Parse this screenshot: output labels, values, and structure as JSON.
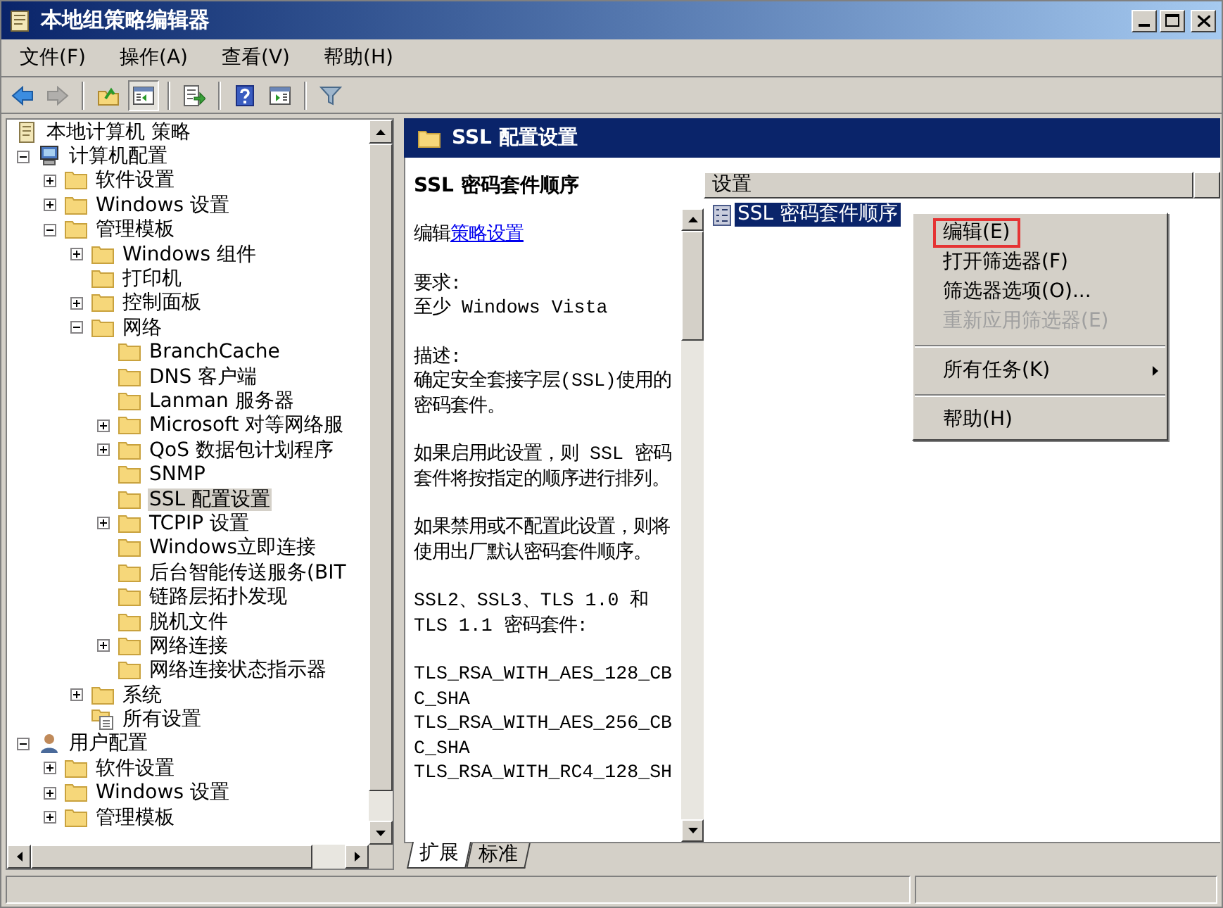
{
  "window": {
    "title": "本地组策略编辑器"
  },
  "menu": [
    "文件(F)",
    "操作(A)",
    "查看(V)",
    "帮助(H)"
  ],
  "toolbar": [
    {
      "kind": "back",
      "disabled": false,
      "pressed": false
    },
    {
      "kind": "forward",
      "disabled": true,
      "pressed": false
    },
    {
      "kind": "separator"
    },
    {
      "kind": "up",
      "disabled": false,
      "pressed": false
    },
    {
      "kind": "tree",
      "disabled": false,
      "pressed": true
    },
    {
      "kind": "separator"
    },
    {
      "kind": "export",
      "disabled": false,
      "pressed": false
    },
    {
      "kind": "separator"
    },
    {
      "kind": "help",
      "disabled": false,
      "pressed": false
    },
    {
      "kind": "action-pane",
      "disabled": false,
      "pressed": false
    },
    {
      "kind": "separator"
    },
    {
      "kind": "filter",
      "disabled": false,
      "pressed": false
    }
  ],
  "tree": [
    {
      "label": "本地计算机 策略",
      "kind": "policy",
      "selected": false,
      "children": [
        {
          "label": "计算机配置",
          "kind": "computer",
          "expandable": true,
          "expanded": true,
          "selected": false,
          "children": [
            {
              "label": "软件设置",
              "kind": "folder",
              "expandable": true,
              "expanded": false,
              "selected": false
            },
            {
              "label": "Windows 设置",
              "kind": "folder",
              "expandable": true,
              "expanded": false,
              "selected": false
            },
            {
              "label": "管理模板",
              "kind": "folder",
              "expandable": true,
              "expanded": true,
              "selected": false,
              "children": [
                {
                  "label": "Windows 组件",
                  "kind": "folder",
                  "expandable": true,
                  "expanded": false,
                  "selected": false
                },
                {
                  "label": "打印机",
                  "kind": "folder",
                  "expandable": false,
                  "selected": false
                },
                {
                  "label": "控制面板",
                  "kind": "folder",
                  "expandable": true,
                  "expanded": false,
                  "selected": false
                },
                {
                  "label": "网络",
                  "kind": "folder",
                  "expandable": true,
                  "expanded": true,
                  "selected": false,
                  "children": [
                    {
                      "label": "BranchCache",
                      "kind": "folder",
                      "expandable": false,
                      "selected": false
                    },
                    {
                      "label": "DNS 客户端",
                      "kind": "folder",
                      "expandable": false,
                      "selected": false
                    },
                    {
                      "label": "Lanman 服务器",
                      "kind": "folder",
                      "expandable": false,
                      "selected": false
                    },
                    {
                      "label": "Microsoft 对等网络服",
                      "kind": "folder",
                      "expandable": true,
                      "expanded": false,
                      "selected": false
                    },
                    {
                      "label": "QoS 数据包计划程序",
                      "kind": "folder",
                      "expandable": true,
                      "expanded": false,
                      "selected": false
                    },
                    {
                      "label": "SNMP",
                      "kind": "folder",
                      "expandable": false,
                      "selected": false
                    },
                    {
                      "label": "SSL 配置设置",
                      "kind": "folder",
                      "expandable": false,
                      "selected": true
                    },
                    {
                      "label": "TCPIP 设置",
                      "kind": "folder",
                      "expandable": true,
                      "expanded": false,
                      "selected": false
                    },
                    {
                      "label": "Windows立即连接",
                      "kind": "folder",
                      "expandable": false,
                      "selected": false
                    },
                    {
                      "label": "后台智能传送服务(BIT",
                      "kind": "folder",
                      "expandable": false,
                      "selected": false
                    },
                    {
                      "label": "链路层拓扑发现",
                      "kind": "folder",
                      "expandable": false,
                      "selected": false
                    },
                    {
                      "label": "脱机文件",
                      "kind": "folder",
                      "expandable": false,
                      "selected": false
                    },
                    {
                      "label": "网络连接",
                      "kind": "folder",
                      "expandable": true,
                      "expanded": false,
                      "selected": false
                    },
                    {
                      "label": "网络连接状态指示器",
                      "kind": "folder",
                      "expandable": false,
                      "selected": false
                    }
                  ]
                },
                {
                  "label": "系统",
                  "kind": "folder",
                  "expandable": true,
                  "expanded": false,
                  "selected": false
                },
                {
                  "label": "所有设置",
                  "kind": "settings",
                  "expandable": false,
                  "selected": false
                }
              ]
            }
          ]
        },
        {
          "label": "用户配置",
          "kind": "user",
          "expandable": true,
          "expanded": true,
          "selected": false,
          "children": [
            {
              "label": "软件设置",
              "kind": "folder",
              "expandable": true,
              "expanded": false,
              "selected": false
            },
            {
              "label": "Windows 设置",
              "kind": "folder",
              "expandable": true,
              "expanded": false,
              "selected": false
            },
            {
              "label": "管理模板",
              "kind": "folder",
              "expandable": true,
              "expanded": false,
              "selected": false
            }
          ]
        }
      ]
    }
  ],
  "header": {
    "title": "SSL 配置设置"
  },
  "description": {
    "heading": "SSL 密码套件顺序",
    "edit_prefix": "编辑",
    "edit_link": "策略设置",
    "paragraphs": [
      "要求:\n至少 Windows Vista",
      "描述:\n确定安全套接字层(SSL)使用的密码套件。",
      "如果启用此设置，则 SSL 密码套件将按指定的顺序进行排列。",
      "如果禁用或不配置此设置，则将使用出厂默认密码套件顺序。",
      "SSL2、SSL3、TLS 1.0 和 TLS 1.1 密码套件:",
      "TLS_RSA_WITH_AES_128_CBC_SHA\nTLS_RSA_WITH_AES_256_CBC_SHA\nTLS_RSA_WITH_RC4_128_SH"
    ]
  },
  "list": {
    "columns": [
      "设置"
    ],
    "rows": [
      {
        "label": "SSL 密码套件顺序",
        "selected": true
      }
    ]
  },
  "context_menu": [
    {
      "kind": "item",
      "label": "编辑(E)",
      "disabled": false,
      "highlighted": true
    },
    {
      "kind": "item",
      "label": "打开筛选器(F)",
      "disabled": false,
      "highlighted": false
    },
    {
      "kind": "item",
      "label": "筛选器选项(O)...",
      "disabled": false,
      "highlighted": false
    },
    {
      "kind": "item",
      "label": "重新应用筛选器(E)",
      "disabled": true,
      "highlighted": false
    },
    {
      "kind": "separator"
    },
    {
      "kind": "submenu",
      "label": "所有任务(K)",
      "disabled": false,
      "highlighted": false
    },
    {
      "kind": "separator"
    },
    {
      "kind": "item",
      "label": "帮助(H)",
      "disabled": false,
      "highlighted": false
    }
  ],
  "tabs": [
    {
      "label": "扩展",
      "selected": true
    },
    {
      "label": "标准",
      "selected": false
    }
  ]
}
